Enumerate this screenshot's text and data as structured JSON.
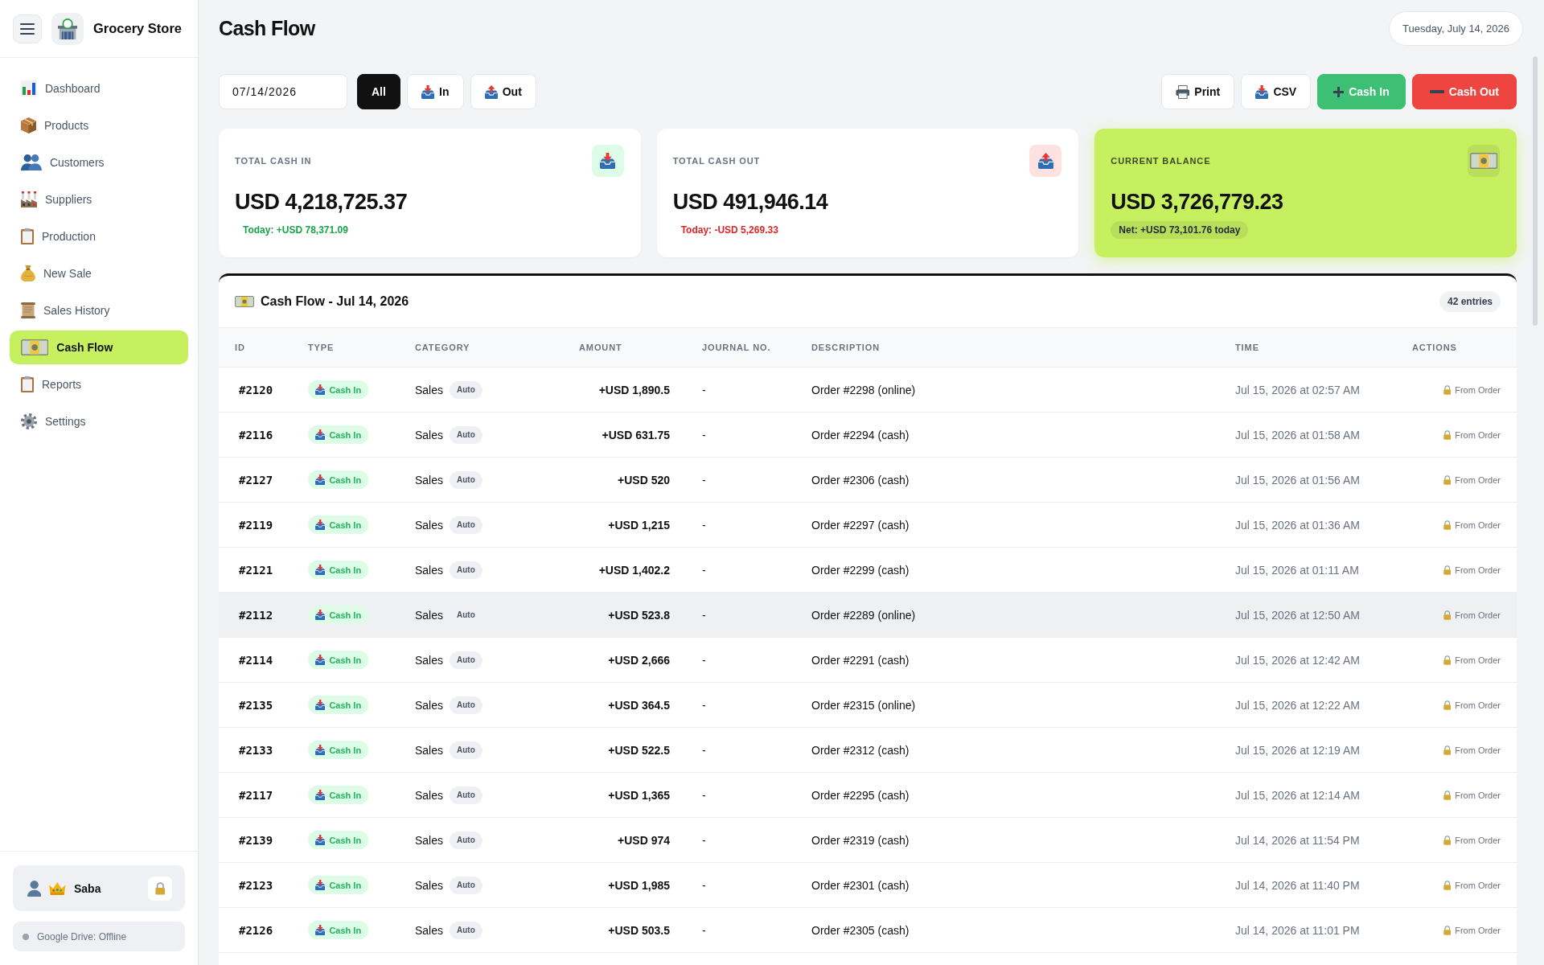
{
  "sidebar": {
    "brand": "Grocery Store",
    "items": [
      {
        "label": "Dashboard",
        "selected": false
      },
      {
        "label": "Products",
        "selected": false
      },
      {
        "label": "Customers",
        "selected": false
      },
      {
        "label": "Suppliers",
        "selected": false
      },
      {
        "label": "Production",
        "selected": false
      },
      {
        "label": "New Sale",
        "selected": false
      },
      {
        "label": "Sales History",
        "selected": false
      },
      {
        "label": "Cash Flow",
        "selected": true
      },
      {
        "label": "Reports",
        "selected": false
      },
      {
        "label": "Settings",
        "selected": false
      }
    ],
    "user": {
      "name": "Saba"
    },
    "drive": {
      "label": "Google Drive: Offline",
      "online": false
    }
  },
  "header": {
    "title": "Cash Flow",
    "date": "Tuesday, July 14, 2026"
  },
  "filters": {
    "date": "07/14/2026",
    "tabs": [
      {
        "label": "All",
        "kind": "all",
        "selected": true
      },
      {
        "label": "In",
        "kind": "in",
        "selected": false
      },
      {
        "label": "Out",
        "kind": "out",
        "selected": false
      }
    ]
  },
  "actions": [
    {
      "label": "Print",
      "kind": "print"
    },
    {
      "label": "CSV",
      "kind": "export"
    },
    {
      "label": "Cash In",
      "kind": "income"
    },
    {
      "label": "Cash Out",
      "kind": "expense"
    }
  ],
  "summary_cards": [
    {
      "kind": "in",
      "label": "TOTAL CASH IN",
      "value": "USD 4,218,725.37",
      "note": "Today: +USD 78,371.09"
    },
    {
      "kind": "out",
      "label": "TOTAL CASH OUT",
      "value": "USD 491,946.14",
      "note": "Today: -USD 5,269.33"
    },
    {
      "kind": "balance",
      "label": "CURRENT BALANCE",
      "value": "USD 3,726,779.23",
      "note": "Net: +USD 73,101.76 today"
    }
  ],
  "table": {
    "title": "Cash Flow - Jul 14, 2026",
    "count": "42 entries",
    "columns": [
      "ID",
      "TYPE",
      "CATEGORY",
      "AMOUNT",
      "JOURNAL NO.",
      "DESCRIPTION",
      "TIME",
      "ACTIONS"
    ],
    "rows": [
      {
        "id": "#2120",
        "type": {
          "label": "Cash In",
          "kind": "in"
        },
        "category": "Sales",
        "tag": "Auto",
        "amount": "+USD 1,890.5",
        "journal": "-",
        "description": "Order #2298 (online)",
        "time": "Jul 15, 2026 at 02:57 AM",
        "action": "From Order",
        "hovered": false
      },
      {
        "id": "#2116",
        "type": {
          "label": "Cash In",
          "kind": "in"
        },
        "category": "Sales",
        "tag": "Auto",
        "amount": "+USD 631.75",
        "journal": "-",
        "description": "Order #2294 (cash)",
        "time": "Jul 15, 2026 at 01:58 AM",
        "action": "From Order",
        "hovered": false
      },
      {
        "id": "#2127",
        "type": {
          "label": "Cash In",
          "kind": "in"
        },
        "category": "Sales",
        "tag": "Auto",
        "amount": "+USD 520",
        "journal": "-",
        "description": "Order #2306 (cash)",
        "time": "Jul 15, 2026 at 01:56 AM",
        "action": "From Order",
        "hovered": false
      },
      {
        "id": "#2119",
        "type": {
          "label": "Cash In",
          "kind": "in"
        },
        "category": "Sales",
        "tag": "Auto",
        "amount": "+USD 1,215",
        "journal": "-",
        "description": "Order #2297 (cash)",
        "time": "Jul 15, 2026 at 01:36 AM",
        "action": "From Order",
        "hovered": false
      },
      {
        "id": "#2121",
        "type": {
          "label": "Cash In",
          "kind": "in"
        },
        "category": "Sales",
        "tag": "Auto",
        "amount": "+USD 1,402.2",
        "journal": "-",
        "description": "Order #2299 (cash)",
        "time": "Jul 15, 2026 at 01:11 AM",
        "action": "From Order",
        "hovered": false
      },
      {
        "id": "#2112",
        "type": {
          "label": "Cash In",
          "kind": "in"
        },
        "category": "Sales",
        "tag": "Auto",
        "amount": "+USD 523.8",
        "journal": "-",
        "description": "Order #2289 (online)",
        "time": "Jul 15, 2026 at 12:50 AM",
        "action": "From Order",
        "hovered": true
      },
      {
        "id": "#2114",
        "type": {
          "label": "Cash In",
          "kind": "in"
        },
        "category": "Sales",
        "tag": "Auto",
        "amount": "+USD 2,666",
        "journal": "-",
        "description": "Order #2291 (cash)",
        "time": "Jul 15, 2026 at 12:42 AM",
        "action": "From Order",
        "hovered": false
      },
      {
        "id": "#2135",
        "type": {
          "label": "Cash In",
          "kind": "in"
        },
        "category": "Sales",
        "tag": "Auto",
        "amount": "+USD 364.5",
        "journal": "-",
        "description": "Order #2315 (online)",
        "time": "Jul 15, 2026 at 12:22 AM",
        "action": "From Order",
        "hovered": false
      },
      {
        "id": "#2133",
        "type": {
          "label": "Cash In",
          "kind": "in"
        },
        "category": "Sales",
        "tag": "Auto",
        "amount": "+USD 522.5",
        "journal": "-",
        "description": "Order #2312 (cash)",
        "time": "Jul 15, 2026 at 12:19 AM",
        "action": "From Order",
        "hovered": false
      },
      {
        "id": "#2117",
        "type": {
          "label": "Cash In",
          "kind": "in"
        },
        "category": "Sales",
        "tag": "Auto",
        "amount": "+USD 1,365",
        "journal": "-",
        "description": "Order #2295 (cash)",
        "time": "Jul 15, 2026 at 12:14 AM",
        "action": "From Order",
        "hovered": false
      },
      {
        "id": "#2139",
        "type": {
          "label": "Cash In",
          "kind": "in"
        },
        "category": "Sales",
        "tag": "Auto",
        "amount": "+USD 974",
        "journal": "-",
        "description": "Order #2319 (cash)",
        "time": "Jul 14, 2026 at 11:54 PM",
        "action": "From Order",
        "hovered": false
      },
      {
        "id": "#2123",
        "type": {
          "label": "Cash In",
          "kind": "in"
        },
        "category": "Sales",
        "tag": "Auto",
        "amount": "+USD 1,985",
        "journal": "-",
        "description": "Order #2301 (cash)",
        "time": "Jul 14, 2026 at 11:40 PM",
        "action": "From Order",
        "hovered": false
      },
      {
        "id": "#2126",
        "type": {
          "label": "Cash In",
          "kind": "in"
        },
        "category": "Sales",
        "tag": "Auto",
        "amount": "+USD 503.5",
        "journal": "-",
        "description": "Order #2305 (cash)",
        "time": "Jul 14, 2026 at 11:01 PM",
        "action": "From Order",
        "hovered": false
      }
    ]
  }
}
